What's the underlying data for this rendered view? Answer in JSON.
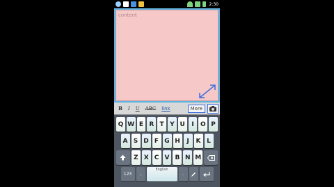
{
  "status_bar": {
    "time": "2:30",
    "icons": [
      "add-contact-icon",
      "app-icon",
      "notification-icon",
      "cleaner-icon",
      "wifi-icon",
      "signal-icon",
      "battery-icon"
    ]
  },
  "editor": {
    "placeholder": "content"
  },
  "toolbar": {
    "bold": "B",
    "italic": "I",
    "underline": "U",
    "strike": "ABC",
    "link": "link",
    "more": "More",
    "camera_icon": "camera-icon"
  },
  "keyboard": {
    "row1": [
      "Q",
      "W",
      "E",
      "R",
      "T",
      "Y",
      "U",
      "I",
      "O",
      "P"
    ],
    "row2": [
      "A",
      "S",
      "D",
      "F",
      "G",
      "H",
      "J",
      "K",
      "L"
    ],
    "row3": [
      "Z",
      "X",
      "C",
      "V",
      "B",
      "N",
      "M"
    ],
    "numbers_label": "123",
    "comma": ",",
    "space_label": "English",
    "period": "."
  },
  "colors": {
    "editor_bg": "#f6c8c8",
    "editor_frame": "#5db3e0",
    "keyboard_bg": "#4c5560",
    "accent": "#3a6ee0"
  }
}
